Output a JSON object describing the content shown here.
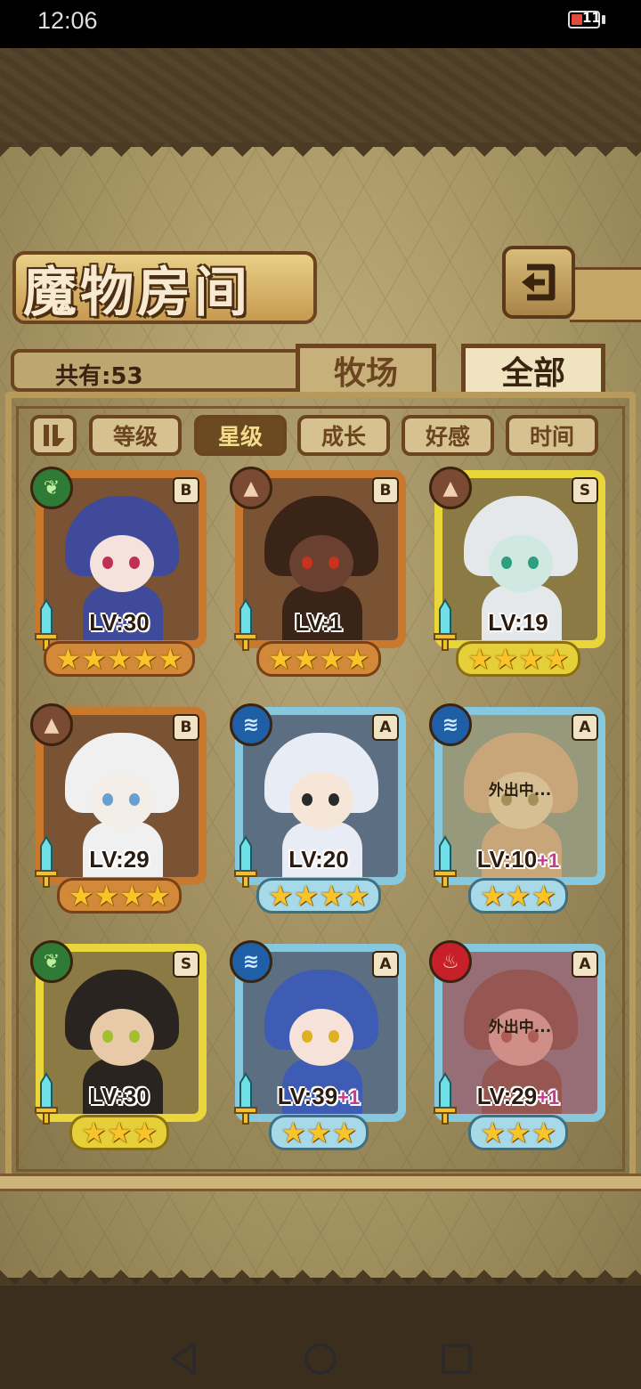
{
  "status": {
    "time": "12:06",
    "battery": "11"
  },
  "title": "魔物房间",
  "count_label": "共有:53",
  "tabs": [
    {
      "label": "牧场"
    },
    {
      "label": "全部"
    }
  ],
  "filters": [
    {
      "label": "等级",
      "active": false
    },
    {
      "label": "星级",
      "active": true
    },
    {
      "label": "成长",
      "active": false
    },
    {
      "label": "好感",
      "active": false
    },
    {
      "label": "时间",
      "active": false
    }
  ],
  "cards": [
    {
      "element": "leaf",
      "rank": "B",
      "level": "LV:30",
      "bonus": "",
      "stars": "★★★★★",
      "away": "",
      "theme": "bronze"
    },
    {
      "element": "earth",
      "rank": "B",
      "level": "LV:1",
      "bonus": "",
      "stars": "★★★★",
      "away": "",
      "theme": "bronze"
    },
    {
      "element": "earth",
      "rank": "S",
      "level": "LV:19",
      "bonus": "",
      "stars": "★★★★",
      "away": "",
      "theme": "gold"
    },
    {
      "element": "earth",
      "rank": "B",
      "level": "LV:29",
      "bonus": "",
      "stars": "★★★★",
      "away": "",
      "theme": "bronze"
    },
    {
      "element": "water",
      "rank": "A",
      "level": "LV:20",
      "bonus": "",
      "stars": "★★★★",
      "away": "",
      "theme": "blue"
    },
    {
      "element": "water",
      "rank": "A",
      "level": "LV:10",
      "bonus": "+1",
      "stars": "★★★",
      "away": "外出中...",
      "theme": "blue"
    },
    {
      "element": "leaf",
      "rank": "S",
      "level": "LV:30",
      "bonus": "",
      "stars": "★★★",
      "away": "",
      "theme": "gold"
    },
    {
      "element": "water",
      "rank": "A",
      "level": "LV:39",
      "bonus": "+1",
      "stars": "★★★",
      "away": "",
      "theme": "blue"
    },
    {
      "element": "fire",
      "rank": "A",
      "level": "LV:29",
      "bonus": "+1",
      "stars": "★★★",
      "away": "外出中...",
      "theme": "blue"
    }
  ]
}
